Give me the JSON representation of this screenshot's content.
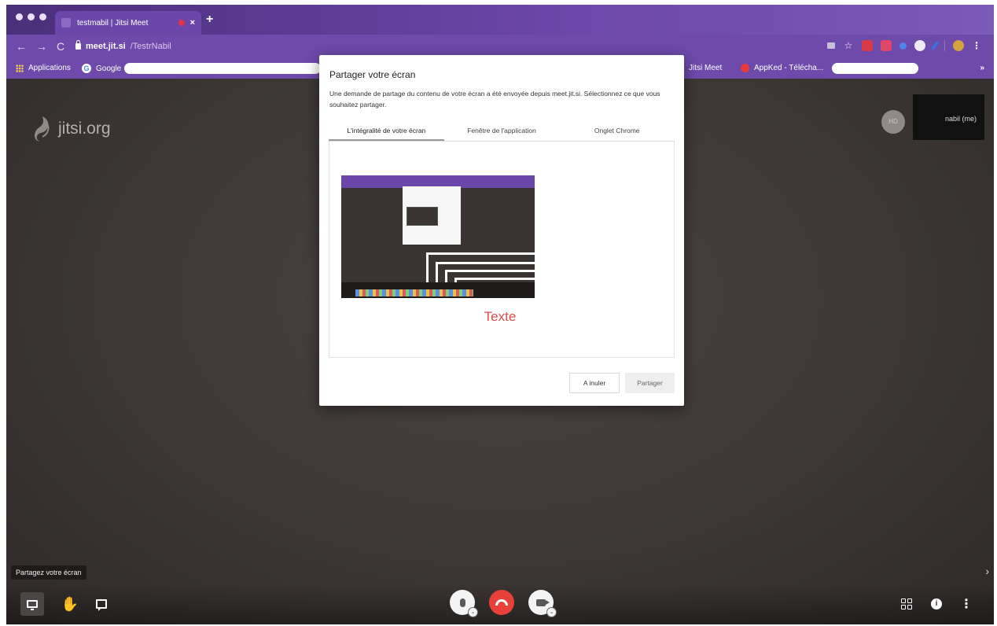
{
  "browser": {
    "tab_title": "testmabil | Jitsi Meet",
    "tab_close": "×",
    "new_tab": "+",
    "nav_back": "←",
    "nav_forward": "→",
    "nav_reload": "C",
    "url_host": "meet.jit.si",
    "url_path": "/TestrNabil",
    "extensions_more": "⋮",
    "profile_initial": "n"
  },
  "bookmarks": {
    "apps_label": "Applications",
    "google_label": "Google",
    "google_glyph": "G",
    "jitsi_label": "Jitsi Meet",
    "appked_label": "AppKed - Télécha...",
    "more": "»"
  },
  "meeting": {
    "logo_text": "jitsi.org",
    "avatar_initials": "HD",
    "local_participant": "nabil (me)",
    "tooltip": "Partagez votre écran",
    "chevron": "›",
    "info_glyph": "i",
    "more_glyph": "⋮",
    "hand_glyph": "✋"
  },
  "dialog": {
    "title": "Partager votre écran",
    "description": "Une demande de partage du contenu de votre écran a été envoyée depuis meet.jit.si. Sélectionnez ce que vous souhaitez partager.",
    "tabs": [
      {
        "label": "L'intégralité de votre écran"
      },
      {
        "label": "Fenêtre de l'application"
      },
      {
        "label": "Onglet Chrome"
      }
    ],
    "preview_label": "Texte",
    "cancel_label": "A inuler",
    "share_label": "Partager"
  },
  "colors": {
    "chrome_purple": "#6e4aab",
    "stage_bg": "#3d3836",
    "hangup_red": "#e8413a",
    "preview_label_red": "#e54a4a"
  }
}
